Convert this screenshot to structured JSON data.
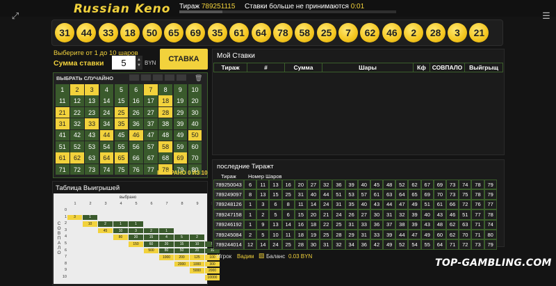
{
  "header": {
    "logo": "Russian Keno",
    "draw_label": "Тираж",
    "draw_number": "789251115",
    "bets_closed_text": "Ставки больше не принимаются",
    "countdown": "0:01",
    "progress": 0.2
  },
  "drawn_balls": [
    "31",
    "44",
    "33",
    "18",
    "50",
    "65",
    "69",
    "35",
    "61",
    "64",
    "78",
    "58",
    "25",
    "7",
    "62",
    "46",
    "2",
    "28",
    "3",
    "21"
  ],
  "controls": {
    "choose_text": "Выберите от 1 до 10 шаров",
    "stake_label": "Сумма ставки",
    "stake_value": "5",
    "currency": "BYN",
    "bet_button": "СТАВКА"
  },
  "grid": {
    "random_label": "ВЫБРАТЬ СЛУЧАЙНО",
    "selected_label": "ВЫБРАНО 0 ИЗ 10",
    "highlighted": [
      2,
      3,
      7,
      18,
      21,
      25,
      28,
      31,
      33,
      35,
      44,
      46,
      50,
      58,
      61,
      62,
      64,
      65,
      69,
      78
    ]
  },
  "paytable": {
    "title": "Таблица Выигрышей",
    "selected_label": "выбрано",
    "match_label": "СОВПАЛО",
    "cols": [
      "1",
      "2",
      "3",
      "4",
      "5",
      "6",
      "7",
      "8",
      "9",
      "10"
    ],
    "rows": [
      {
        "k": "0",
        "c": [
          "",
          "",
          "",
          "",
          "",
          "",
          "",
          "",
          "",
          ""
        ]
      },
      {
        "k": "1",
        "c": [
          "3",
          "1",
          "",
          "",
          "",
          "",
          "",
          "",
          "",
          ""
        ]
      },
      {
        "k": "2",
        "c": [
          "",
          "10",
          "2",
          "1",
          "1",
          "",
          "",
          "",
          "",
          ""
        ]
      },
      {
        "k": "3",
        "c": [
          "",
          "",
          "45",
          "10",
          "3",
          "2",
          "1",
          "",
          "",
          ""
        ]
      },
      {
        "k": "4",
        "c": [
          "",
          "",
          "",
          "80",
          "20",
          "15",
          "4",
          "5",
          "2",
          ""
        ]
      },
      {
        "k": "5",
        "c": [
          "",
          "",
          "",
          "",
          "150",
          "60",
          "20",
          "15",
          "10",
          "5"
        ]
      },
      {
        "k": "6",
        "c": [
          "",
          "",
          "",
          "",
          "",
          "500",
          "80",
          "50",
          "20",
          "10"
        ]
      },
      {
        "k": "7",
        "c": [
          "",
          "",
          "",
          "",
          "",
          "",
          "1000",
          "200",
          "125",
          "100"
        ]
      },
      {
        "k": "8",
        "c": [
          "",
          "",
          "",
          "",
          "",
          "",
          "",
          "2000",
          "1000",
          "300"
        ]
      },
      {
        "k": "9",
        "c": [
          "",
          "",
          "",
          "",
          "",
          "",
          "",
          "",
          "5000",
          "2000"
        ]
      },
      {
        "k": "10",
        "c": [
          "",
          "",
          "",
          "",
          "",
          "",
          "",
          "",
          "",
          "10000"
        ]
      }
    ]
  },
  "my_bets": {
    "title": "Мой Ставки",
    "headers": [
      "Тираж",
      "#",
      "Сумма",
      "Шары",
      "Кф",
      "СОВПАЛО",
      "Выйгрыщ"
    ]
  },
  "last_draws": {
    "title": "последние Тиражт",
    "col_draw": "Тираж",
    "col_numbers": "Номер Шаров",
    "rows": [
      {
        "id": "789250043",
        "n": [
          "6",
          "11",
          "13",
          "16",
          "20",
          "27",
          "32",
          "36",
          "39",
          "40",
          "45",
          "48",
          "52",
          "62",
          "67",
          "69",
          "73",
          "74",
          "78",
          "79"
        ]
      },
      {
        "id": "789249097",
        "n": [
          "8",
          "13",
          "15",
          "25",
          "31",
          "40",
          "44",
          "51",
          "53",
          "57",
          "61",
          "63",
          "64",
          "65",
          "69",
          "70",
          "73",
          "75",
          "78",
          "79"
        ]
      },
      {
        "id": "789248126",
        "n": [
          "1",
          "3",
          "6",
          "8",
          "11",
          "14",
          "24",
          "31",
          "35",
          "40",
          "43",
          "44",
          "47",
          "49",
          "51",
          "61",
          "66",
          "72",
          "76",
          "77"
        ]
      },
      {
        "id": "789247158",
        "n": [
          "1",
          "2",
          "5",
          "6",
          "15",
          "20",
          "21",
          "24",
          "26",
          "27",
          "30",
          "31",
          "32",
          "39",
          "40",
          "43",
          "46",
          "51",
          "77",
          "78"
        ]
      },
      {
        "id": "789246192",
        "n": [
          "1",
          "9",
          "13",
          "14",
          "16",
          "18",
          "22",
          "25",
          "31",
          "33",
          "36",
          "37",
          "38",
          "39",
          "43",
          "48",
          "62",
          "63",
          "71",
          "74"
        ]
      },
      {
        "id": "789245084",
        "n": [
          "2",
          "5",
          "10",
          "11",
          "18",
          "19",
          "25",
          "28",
          "29",
          "31",
          "33",
          "39",
          "44",
          "47",
          "49",
          "60",
          "62",
          "70",
          "71",
          "80"
        ]
      },
      {
        "id": "789244014",
        "n": [
          "12",
          "14",
          "24",
          "25",
          "28",
          "30",
          "31",
          "32",
          "34",
          "36",
          "42",
          "49",
          "52",
          "54",
          "55",
          "64",
          "71",
          "72",
          "73",
          "79"
        ]
      }
    ]
  },
  "footer": {
    "player_label": "Игрок",
    "player_name": "Вадим",
    "balance_label": "Баланс",
    "balance_value": "0.03 BYN"
  },
  "watermark": "TOP-GAMBLING.COM",
  "colors": {
    "accent": "#f2d23c",
    "cell": "#3a5a2c",
    "background": "#141414"
  }
}
